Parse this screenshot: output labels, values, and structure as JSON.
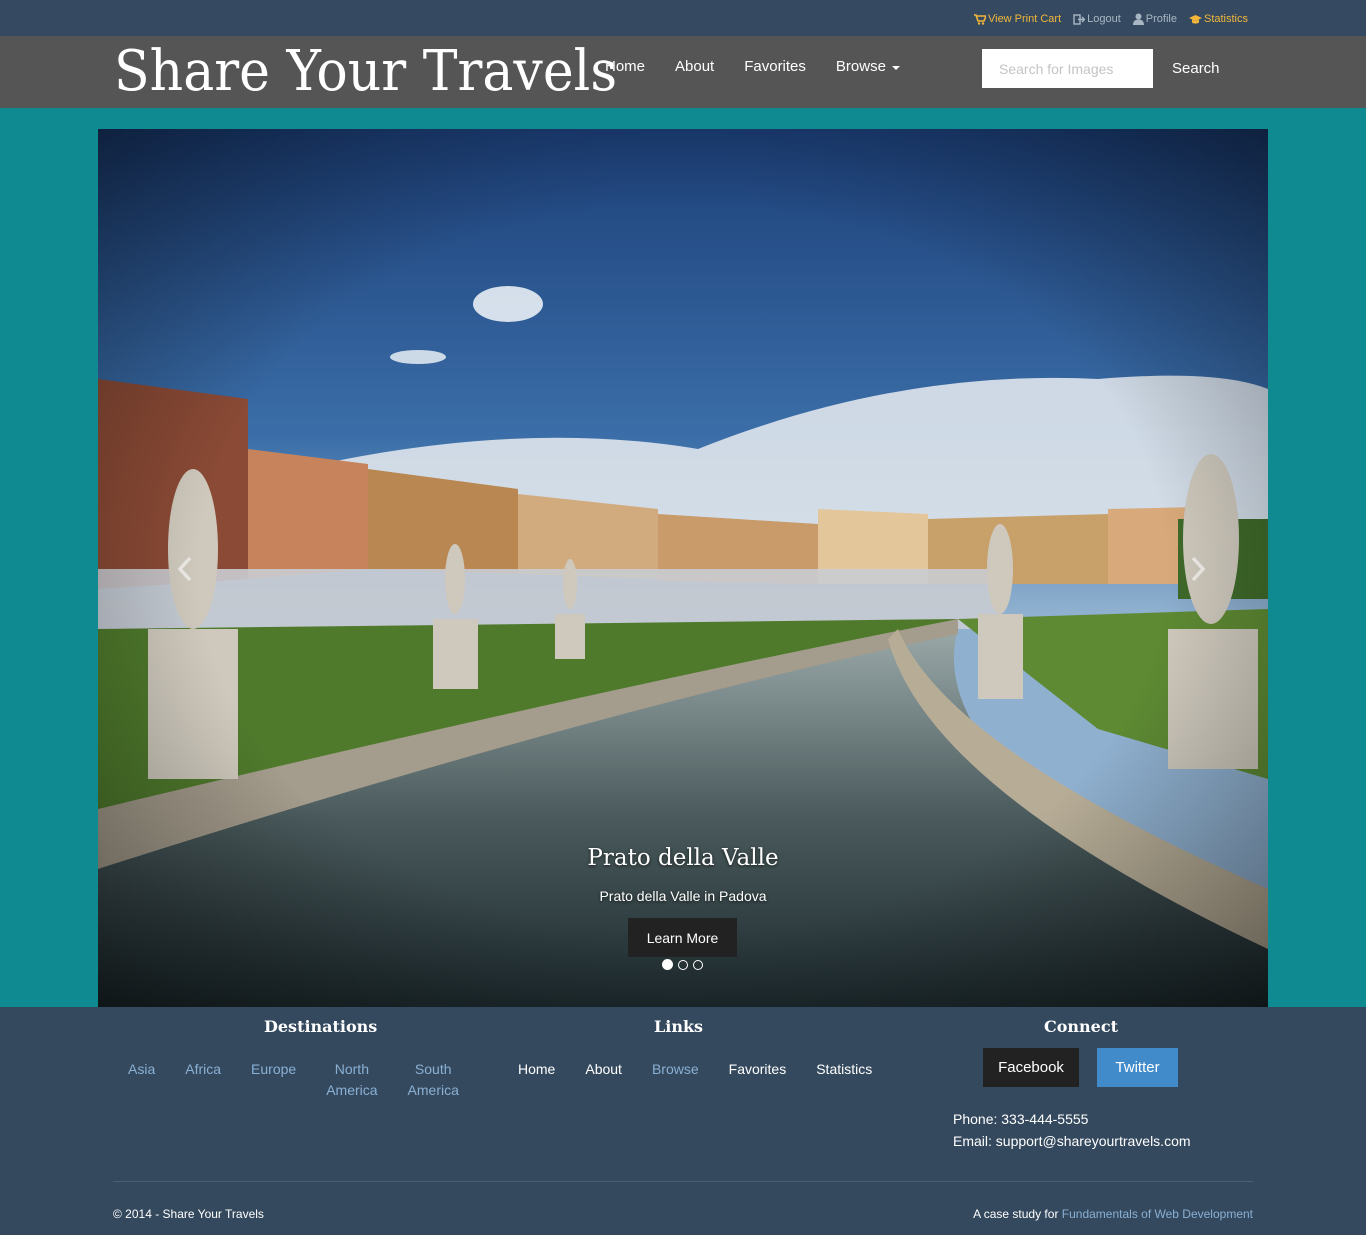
{
  "utility": {
    "cart_label": "View Print Cart",
    "logout_label": "Logout",
    "profile_label": "Profile",
    "statistics_label": "Statistics"
  },
  "navbar": {
    "brand": "Share Your Travels",
    "items": [
      {
        "label": "Home"
      },
      {
        "label": "About"
      },
      {
        "label": "Favorites"
      },
      {
        "label": "Browse"
      }
    ],
    "search_placeholder": "Search for Images",
    "search_label": "Search"
  },
  "carousel": {
    "caption_title": "Prato della Valle",
    "caption_text": "Prato della Valle in Padova",
    "button_label": "Learn More",
    "slide_count": 3,
    "active_slide": 1
  },
  "footer": {
    "destinations_heading": "Destinations",
    "destinations": [
      {
        "label": "Asia"
      },
      {
        "label": "Africa"
      },
      {
        "label": "Europe"
      },
      {
        "line1": "North",
        "line2": "America"
      },
      {
        "line1": "South",
        "line2": "America"
      }
    ],
    "links_heading": "Links",
    "links": [
      {
        "label": "Home"
      },
      {
        "label": "About"
      },
      {
        "label": "Browse"
      },
      {
        "label": "Favorites"
      },
      {
        "label": "Statistics"
      }
    ],
    "connect_heading": "Connect",
    "facebook_label": "Facebook",
    "twitter_label": "Twitter",
    "phone": "Phone: 333-444-5555",
    "email": "Email: support@shareyourtravels.com",
    "copyright": "© 2014 - Share Your Travels",
    "case_study_prefix": "A case study for ",
    "case_study_link": "Fundamentals of Web Development"
  },
  "colors": {
    "page_background": "#0f8a91",
    "utility_bar": "#354a60",
    "navbar": "#555555",
    "footer": "#34495e",
    "gold_link": "#f2b63a",
    "footer_link": "#8ab0d4",
    "twitter": "#428bca"
  }
}
